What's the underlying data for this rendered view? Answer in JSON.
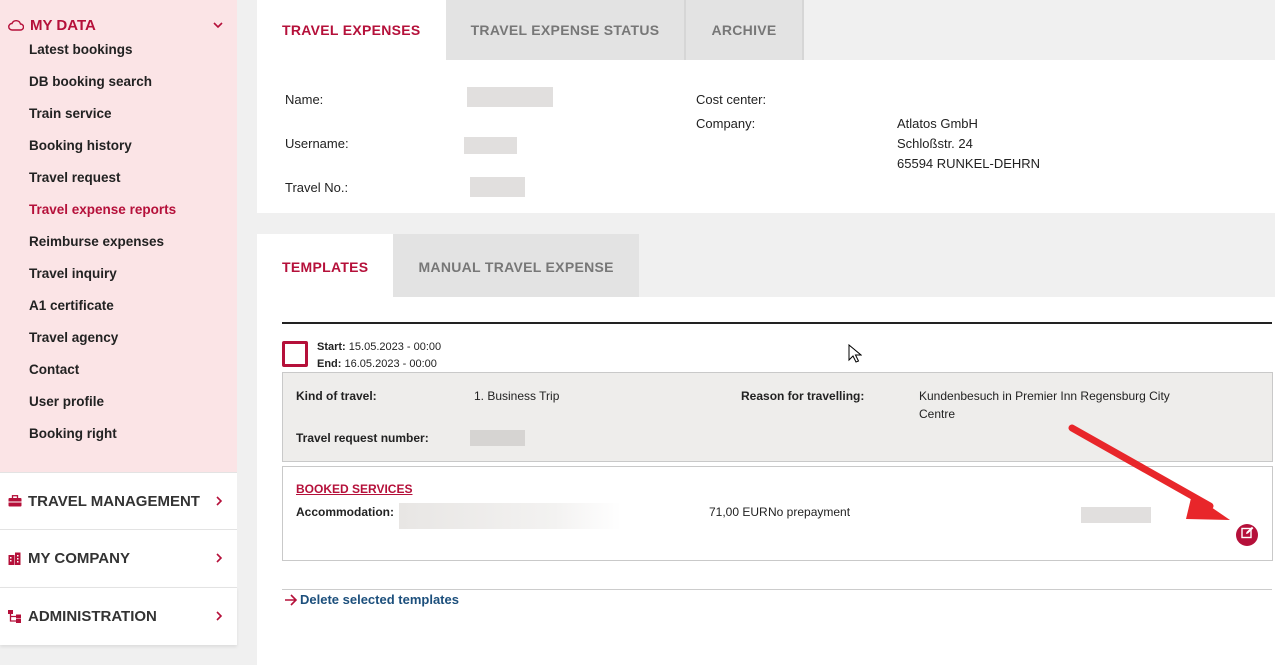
{
  "sidebar": {
    "my_data": {
      "title": "MY DATA",
      "items": [
        {
          "label": "Latest bookings"
        },
        {
          "label": "DB booking search"
        },
        {
          "label": "Train service"
        },
        {
          "label": "Booking history"
        },
        {
          "label": "Travel request"
        },
        {
          "label": "Travel expense reports"
        },
        {
          "label": "Reimburse expenses"
        },
        {
          "label": "Travel inquiry"
        },
        {
          "label": "A1 certificate"
        },
        {
          "label": "Travel agency"
        },
        {
          "label": "Contact"
        },
        {
          "label": "User profile"
        },
        {
          "label": "Booking right"
        }
      ]
    },
    "travel_management": "TRAVEL MANAGEMENT",
    "my_company": "MY COMPANY",
    "administration": "ADMINISTRATION"
  },
  "top_tabs": [
    "TRAVEL EXPENSES",
    "TRAVEL EXPENSE STATUS",
    "ARCHIVE"
  ],
  "traveler": {
    "name_label": "Name:",
    "username_label": "Username:",
    "travel_no_label": "Travel No.:",
    "cost_center_label": "Cost center:",
    "company_label": "Company:",
    "company_lines": [
      "Atlatos GmbH",
      "Schloßstr. 24",
      "65594 RUNKEL-DEHRN"
    ]
  },
  "sub_tabs": [
    "TEMPLATES",
    "MANUAL TRAVEL EXPENSE"
  ],
  "template": {
    "start_label": "Start:",
    "start_value": "15.05.2023 - 00:00",
    "end_label": "End:",
    "end_value": "16.05.2023 - 00:00",
    "kind_label": "Kind of travel:",
    "kind_value": "1. Business Trip",
    "reason_label": "Reason for travelling:",
    "reason_value_line1": "Kundenbesuch in Premier Inn Regensburg City",
    "reason_value_line2": "Centre",
    "request_number_label": "Travel request number:",
    "booked_services_label": "BOOKED SERVICES",
    "accommodation_label": "Accommodation:",
    "accommodation_price": "71,00 EUR",
    "accommodation_payment": "No prepayment"
  },
  "delete_link": "Delete selected templates",
  "colors": {
    "brand": "#b5103a",
    "link": "#1c4f7c",
    "annotation_arrow": "#e8262a"
  }
}
